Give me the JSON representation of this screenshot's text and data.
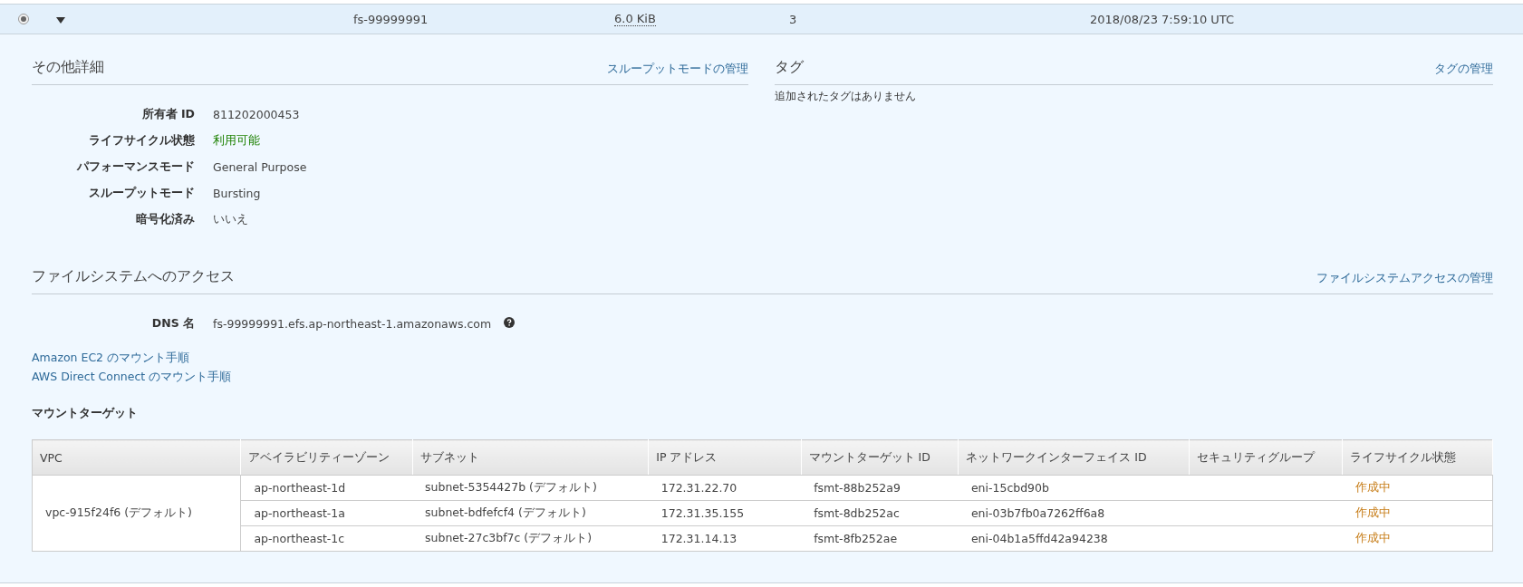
{
  "file_system_row": {
    "selected": true,
    "expanded": true,
    "name": "fs-99999991",
    "size": "6.0 KiB",
    "mount_targets": "3",
    "created": "2018/08/23 7:59:10 UTC"
  },
  "other_details": {
    "title": "その他詳細",
    "action": "スループットモードの管理",
    "items": [
      {
        "label": "所有者 ID",
        "value": "811202000453",
        "kind": "text"
      },
      {
        "label": "ライフサイクル状態",
        "value": "利用可能",
        "kind": "status"
      },
      {
        "label": "パフォーマンスモード",
        "value": "General Purpose",
        "kind": "text"
      },
      {
        "label": "スループットモード",
        "value": "Bursting",
        "kind": "text"
      },
      {
        "label": "暗号化済み",
        "value": "いいえ",
        "kind": "text"
      }
    ]
  },
  "tags": {
    "title": "タグ",
    "action": "タグの管理",
    "empty_message": "追加されたタグはありません"
  },
  "access": {
    "title": "ファイルシステムへのアクセス",
    "action": "ファイルシステムアクセスの管理",
    "dns_label": "DNS 名",
    "dns_value": "fs-99999991.efs.ap-northeast-1.amazonaws.com",
    "links": [
      "Amazon EC2 のマウント手順",
      "AWS Direct Connect のマウント手順"
    ],
    "mount_targets_title": "マウントターゲット",
    "table": {
      "columns": [
        "VPC",
        "アベイラビリティーゾーン",
        "サブネット",
        "IP アドレス",
        "マウントターゲット ID",
        "ネットワークインターフェイス ID",
        "セキュリティグループ",
        "ライフサイクル状態"
      ],
      "rows": [
        [
          "",
          "ap-northeast-1d",
          "subnet-5354427b (デフォルト)",
          "172.31.22.70",
          "fsmt-88b252a9",
          "eni-15cbd90b",
          "",
          "作成中"
        ],
        [
          "vpc-915f24f6 (デフォルト)",
          "ap-northeast-1a",
          "subnet-bdfefcf4 (デフォルト)",
          "172.31.35.155",
          "fsmt-8db252ac",
          "eni-03b7fb0a7262ff6a8",
          "",
          "作成中"
        ],
        [
          "",
          "ap-northeast-1c",
          "subnet-27c3bf7c (デフォルト)",
          "172.31.14.13",
          "fsmt-8fb252ae",
          "eni-04b1a5ffd42a94238",
          "",
          "作成中"
        ]
      ]
    }
  }
}
